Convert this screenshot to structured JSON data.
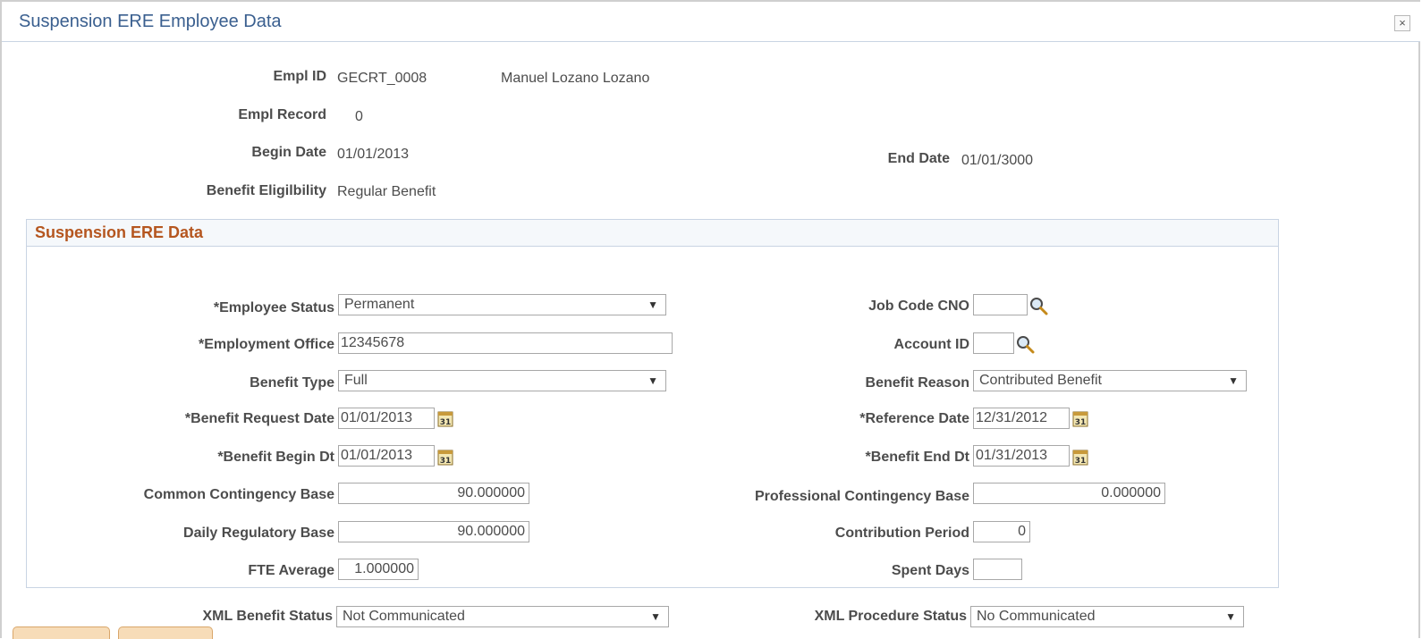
{
  "dialog": {
    "title": "Suspension ERE Employee Data",
    "close_label": "×"
  },
  "header": {
    "empl_id_label": "Empl ID",
    "empl_id": "GECRT_0008",
    "employee_name": "Manuel Lozano Lozano",
    "empl_record_label": "Empl Record",
    "empl_record": "0",
    "begin_date_label": "Begin Date",
    "begin_date": "01/01/2013",
    "end_date_label": "End Date",
    "end_date": "01/01/3000",
    "benefit_elig_label": "Benefit Eligilbility",
    "benefit_elig": "Regular Benefit"
  },
  "section": {
    "title": "Suspension ERE Data",
    "employee_status_label": "*Employee Status",
    "employee_status": "Permanent",
    "employment_office_label": "*Employment Office",
    "employment_office": "12345678",
    "benefit_type_label": "Benefit Type",
    "benefit_type": "Full",
    "benefit_request_date_label": "*Benefit Request Date",
    "benefit_request_date": "01/01/2013",
    "benefit_begin_dt_label": "*Benefit Begin Dt",
    "benefit_begin_dt": "01/01/2013",
    "common_contingency_label": "Common Contingency Base",
    "common_contingency": "90.000000",
    "daily_regulatory_label": "Daily Regulatory Base",
    "daily_regulatory": "90.000000",
    "fte_average_label": "FTE Average",
    "fte_average": "1.000000",
    "job_code_cno_label": "Job Code CNO",
    "job_code_cno": "",
    "account_id_label": "Account ID",
    "account_id": "",
    "benefit_reason_label": "Benefit Reason",
    "benefit_reason": "Contributed Benefit",
    "reference_date_label": "*Reference Date",
    "reference_date": "12/31/2012",
    "benefit_end_dt_label": "*Benefit End Dt",
    "benefit_end_dt": "01/31/2013",
    "professional_contingency_label": "Professional Contingency Base",
    "professional_contingency": "0.000000",
    "contribution_period_label": "Contribution Period",
    "contribution_period": "0",
    "spent_days_label": "Spent Days",
    "spent_days": ""
  },
  "footer": {
    "xml_benefit_status_label": "XML Benefit Status",
    "xml_benefit_status": "Not Communicated",
    "xml_procedure_status_label": "XML Procedure Status",
    "xml_procedure_status": "No Communicated"
  },
  "icons": {
    "lookup": "magnifier-icon",
    "calendar": "calendar-icon",
    "dropdown": "chevron-down-icon"
  },
  "colors": {
    "title": "#3a5f8f",
    "section_title": "#b5561f",
    "border": "#c9d4e3"
  }
}
